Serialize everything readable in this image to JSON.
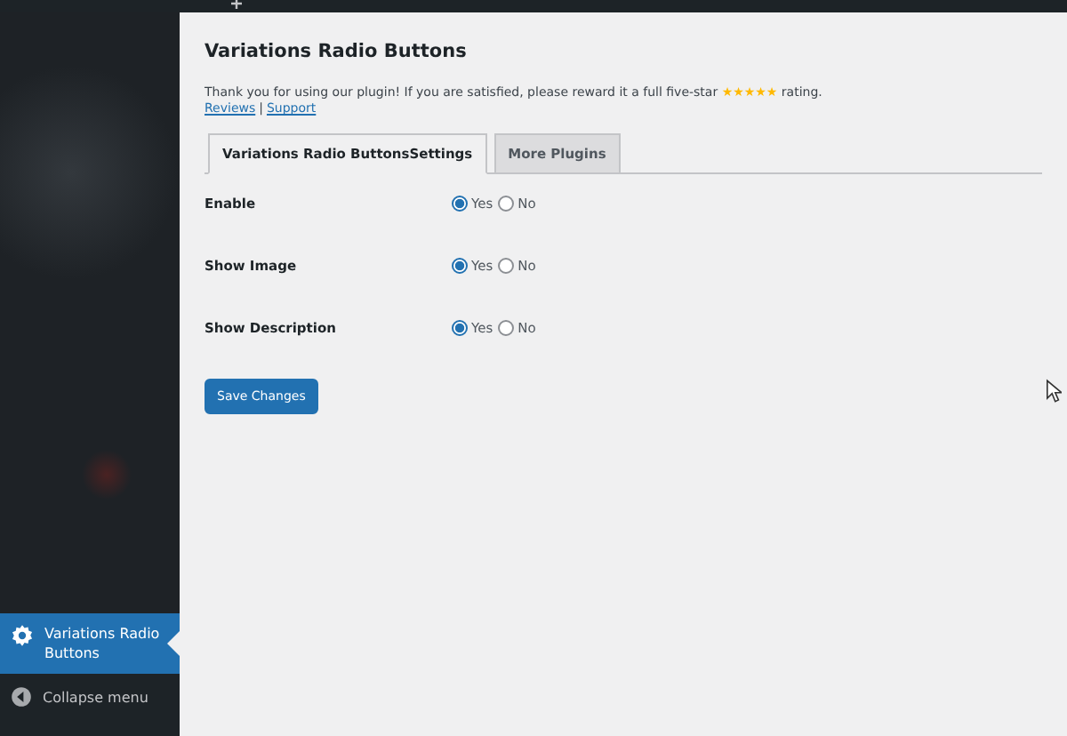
{
  "sidebar": {
    "items": [
      {
        "label": "Variations Radio Buttons",
        "kind": "current",
        "selected": true
      },
      {
        "label": "Collapse menu",
        "kind": "collapse",
        "selected": false
      }
    ]
  },
  "page": {
    "title": "Variations Radio Buttons",
    "notice": {
      "text_before": "Thank you for using our plugin! If you are satisfied, please reward it a full five-star ",
      "stars": "★★★★★",
      "text_after": " rating."
    },
    "links": [
      "Reviews",
      "Support"
    ],
    "link_separator": "|",
    "tabs": [
      {
        "label": "Variations Radio ButtonsSettings",
        "selected": true
      },
      {
        "label": "More Plugins",
        "selected": false
      }
    ],
    "settings": [
      {
        "label": "Enable",
        "options": [
          {
            "label": "Yes",
            "selected": true
          },
          {
            "label": "No",
            "selected": false
          }
        ]
      },
      {
        "label": "Show Image",
        "options": [
          {
            "label": "Yes",
            "selected": true
          },
          {
            "label": "No",
            "selected": false
          }
        ]
      },
      {
        "label": "Show Description",
        "options": [
          {
            "label": "Yes",
            "selected": true
          },
          {
            "label": "No",
            "selected": false
          }
        ]
      }
    ],
    "save_button": "Save Changes"
  }
}
